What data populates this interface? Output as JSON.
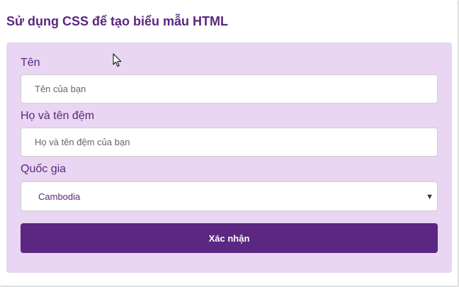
{
  "page": {
    "title": "Sử dụng CSS để tạo biểu mẫu HTML"
  },
  "form": {
    "first_name": {
      "label": "Tên",
      "placeholder": "Tên của bạn",
      "value": ""
    },
    "last_name": {
      "label": "Họ và tên đệm",
      "placeholder": "Họ và tên đệm của bạn",
      "value": ""
    },
    "country": {
      "label": "Quốc gia",
      "selected": "Cambodia",
      "dropdown_icon": "chevron-down-icon"
    },
    "submit_label": "Xác nhận"
  },
  "colors": {
    "accent": "#5b2780",
    "panel_background": "#e8d6f2",
    "input_background": "#ffffff",
    "button_text": "#ffffff"
  },
  "icons": {
    "cursor": "mouse-pointer-icon",
    "dropdown": "chevron-down-icon"
  }
}
